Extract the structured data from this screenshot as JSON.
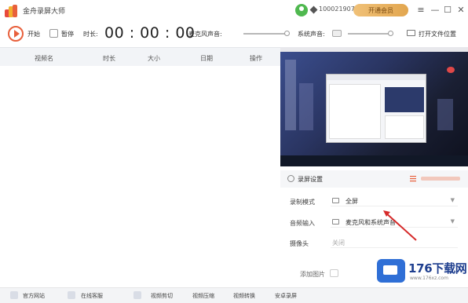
{
  "app": {
    "title": "金舟录屏大师"
  },
  "account": {
    "user_id": "1000219079",
    "vip_label": "开通会员"
  },
  "window_controls": {
    "menu": "≡",
    "minimize": "—",
    "maximize": "☐",
    "close": "✕"
  },
  "toolbar": {
    "start_label": "开始",
    "pause_label": "暂停",
    "duration_label": "时长:",
    "timer": "00 : 00 : 00",
    "mic_label": "麦克风声音:",
    "mic_level": 1.0,
    "system_sound_label": "系统声音:",
    "system_sound_level": 1.0,
    "open_folder_label": "打开文件位置"
  },
  "file_list": {
    "columns": [
      "视频名",
      "时长",
      "大小",
      "日期",
      "操作"
    ],
    "rows": []
  },
  "settings": {
    "title": "录屏设置",
    "rows": [
      {
        "label": "录制模式",
        "value": "全屏"
      },
      {
        "label": "音频输入",
        "value": "麦克风和系统声音"
      },
      {
        "label": "摄像头",
        "value": "关闭"
      }
    ],
    "add_image_label": "添加图片"
  },
  "bottom_nav": [
    {
      "label": "官方网站",
      "icon": "home-icon"
    },
    {
      "label": "在线客服",
      "icon": "headset-icon"
    },
    {
      "label": "视频剪切",
      "icon": "scissors-icon"
    },
    {
      "label": "视频压缩",
      "icon": "compress-icon"
    },
    {
      "label": "视频转换",
      "icon": "convert-icon"
    },
    {
      "label": "安卓录屏",
      "icon": "android-icon"
    }
  ],
  "watermark": {
    "brand": "176下载网",
    "url": "www.176xz.com"
  },
  "colors": {
    "accent_orange": "#e8603c",
    "vip_gold": "#e2a64f",
    "watermark_blue": "#2f6fd6"
  }
}
